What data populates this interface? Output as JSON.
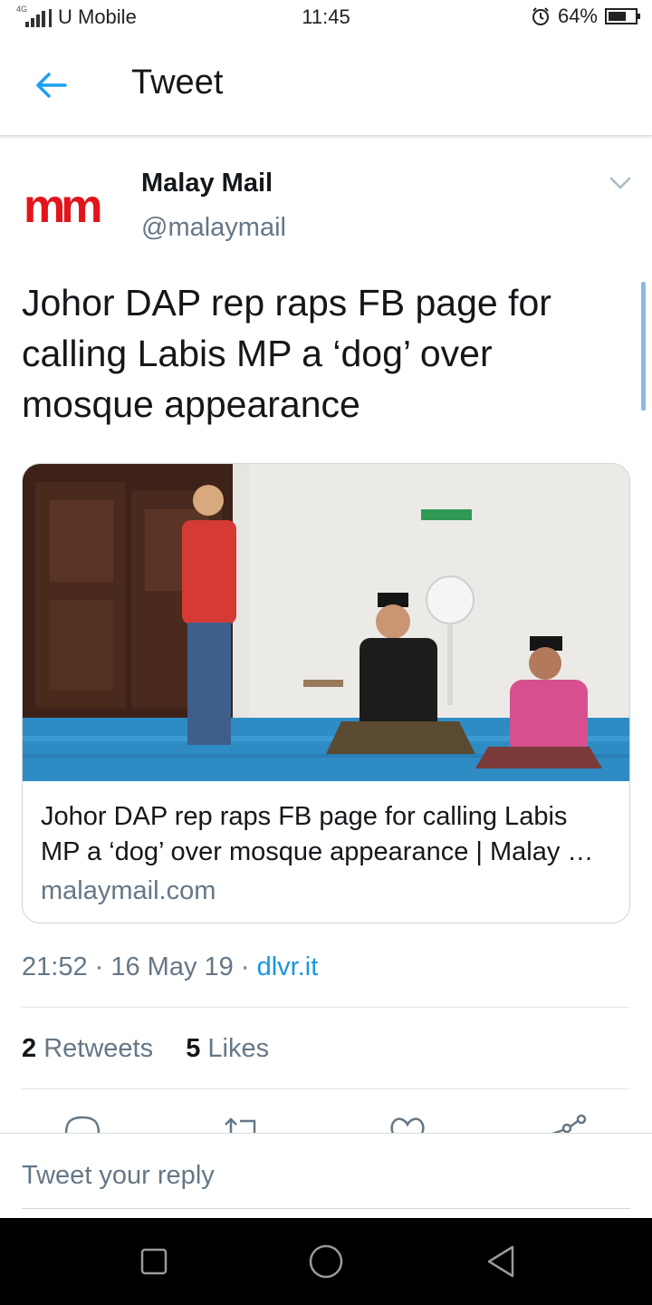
{
  "status_bar": {
    "network": "4G",
    "carrier": "U Mobile",
    "time": "11:45",
    "battery": "64%",
    "icons": [
      "signal-icon",
      "alarm-icon",
      "battery-icon"
    ]
  },
  "header": {
    "title": "Tweet",
    "back_icon": "arrow-left-icon"
  },
  "tweet": {
    "author_name": "Malay Mail",
    "author_handle": "@malaymail",
    "avatar_text": "mm",
    "avatar_color": "#e3141b",
    "text": "Johor DAP rep raps FB page for calling Labis MP a ‘dog’ over mosque appearance",
    "card": {
      "title": "Johor DAP rep raps FB page for calling Labis MP a ‘dog’ over mosque appearance | Malay …",
      "domain": "malaymail.com"
    },
    "time": "21:52",
    "date": "16 May 19",
    "source": "dlvr.it",
    "retweet_count": "2",
    "retweet_label": "Retweets",
    "like_count": "5",
    "like_label": "Likes",
    "actions": [
      "reply-icon",
      "retweet-icon",
      "like-icon",
      "share-icon"
    ]
  },
  "reply": {
    "placeholder": "Tweet your reply"
  },
  "nav": {
    "buttons": [
      "recent-apps-icon",
      "home-icon",
      "back-icon"
    ]
  },
  "colors": {
    "accent": "#1b95e0",
    "secondary_text": "#657786",
    "primary_text": "#14171a"
  }
}
